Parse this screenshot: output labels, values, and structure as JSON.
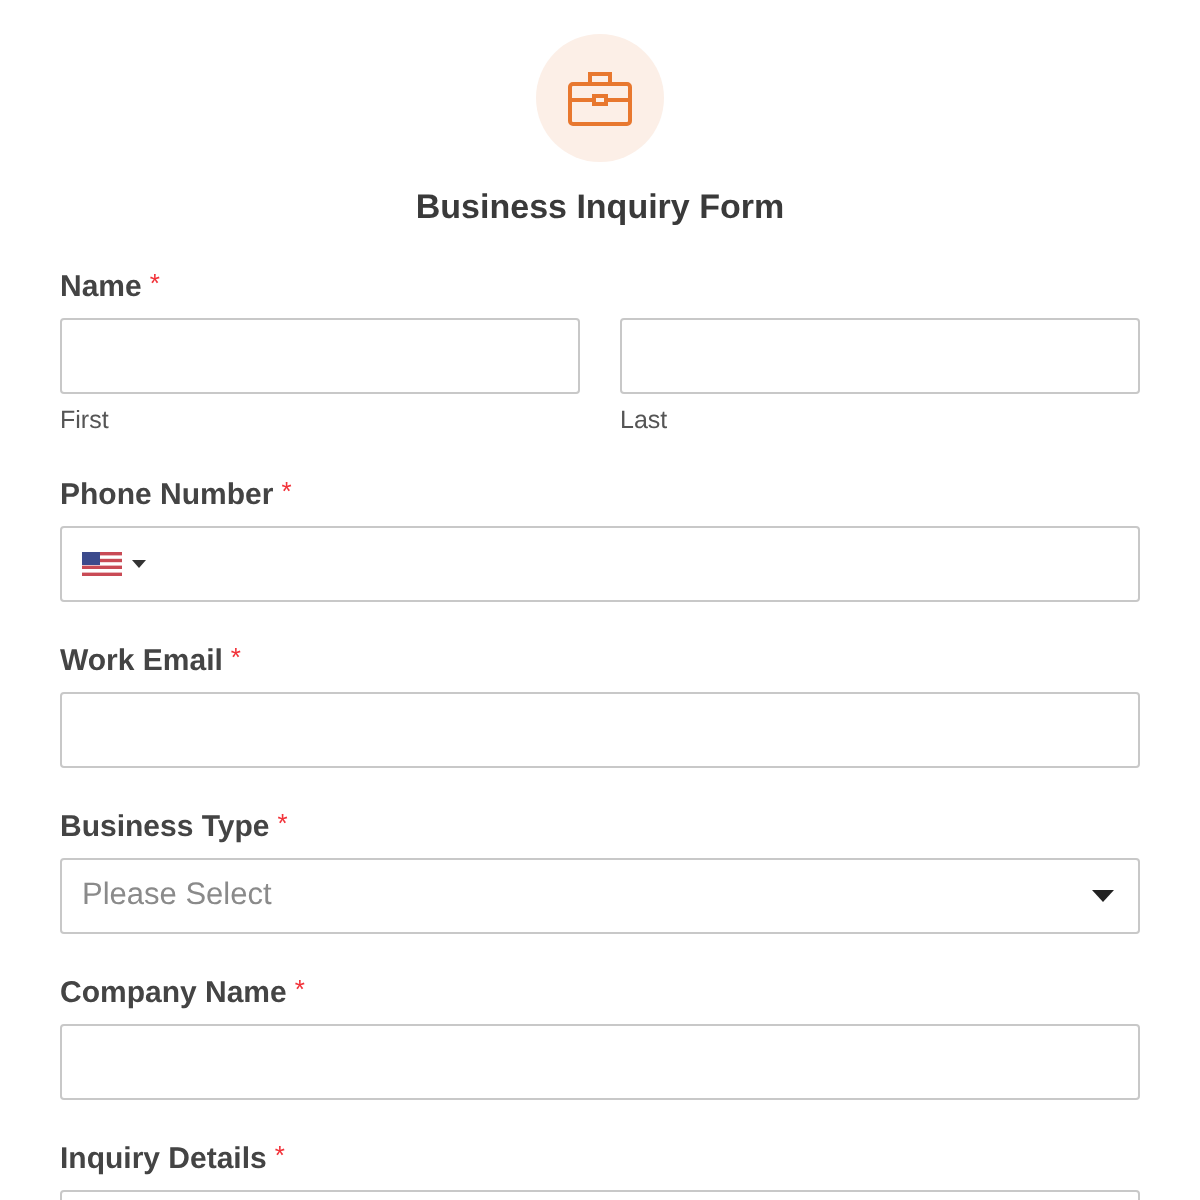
{
  "form": {
    "title": "Business Inquiry Form"
  },
  "fields": [
    {
      "kind": "name",
      "label": "Name",
      "required_mark": "*",
      "sublabels": [
        "First",
        "Last"
      ]
    },
    {
      "kind": "phone",
      "label": "Phone Number",
      "required_mark": "*"
    },
    {
      "kind": "text",
      "label": "Work Email",
      "required_mark": "*"
    },
    {
      "kind": "select",
      "label": "Business Type",
      "required_mark": "*",
      "placeholder": "Please Select"
    },
    {
      "kind": "text",
      "label": "Company Name",
      "required_mark": "*"
    },
    {
      "kind": "textarea",
      "label": "Inquiry Details",
      "required_mark": "*"
    }
  ]
}
